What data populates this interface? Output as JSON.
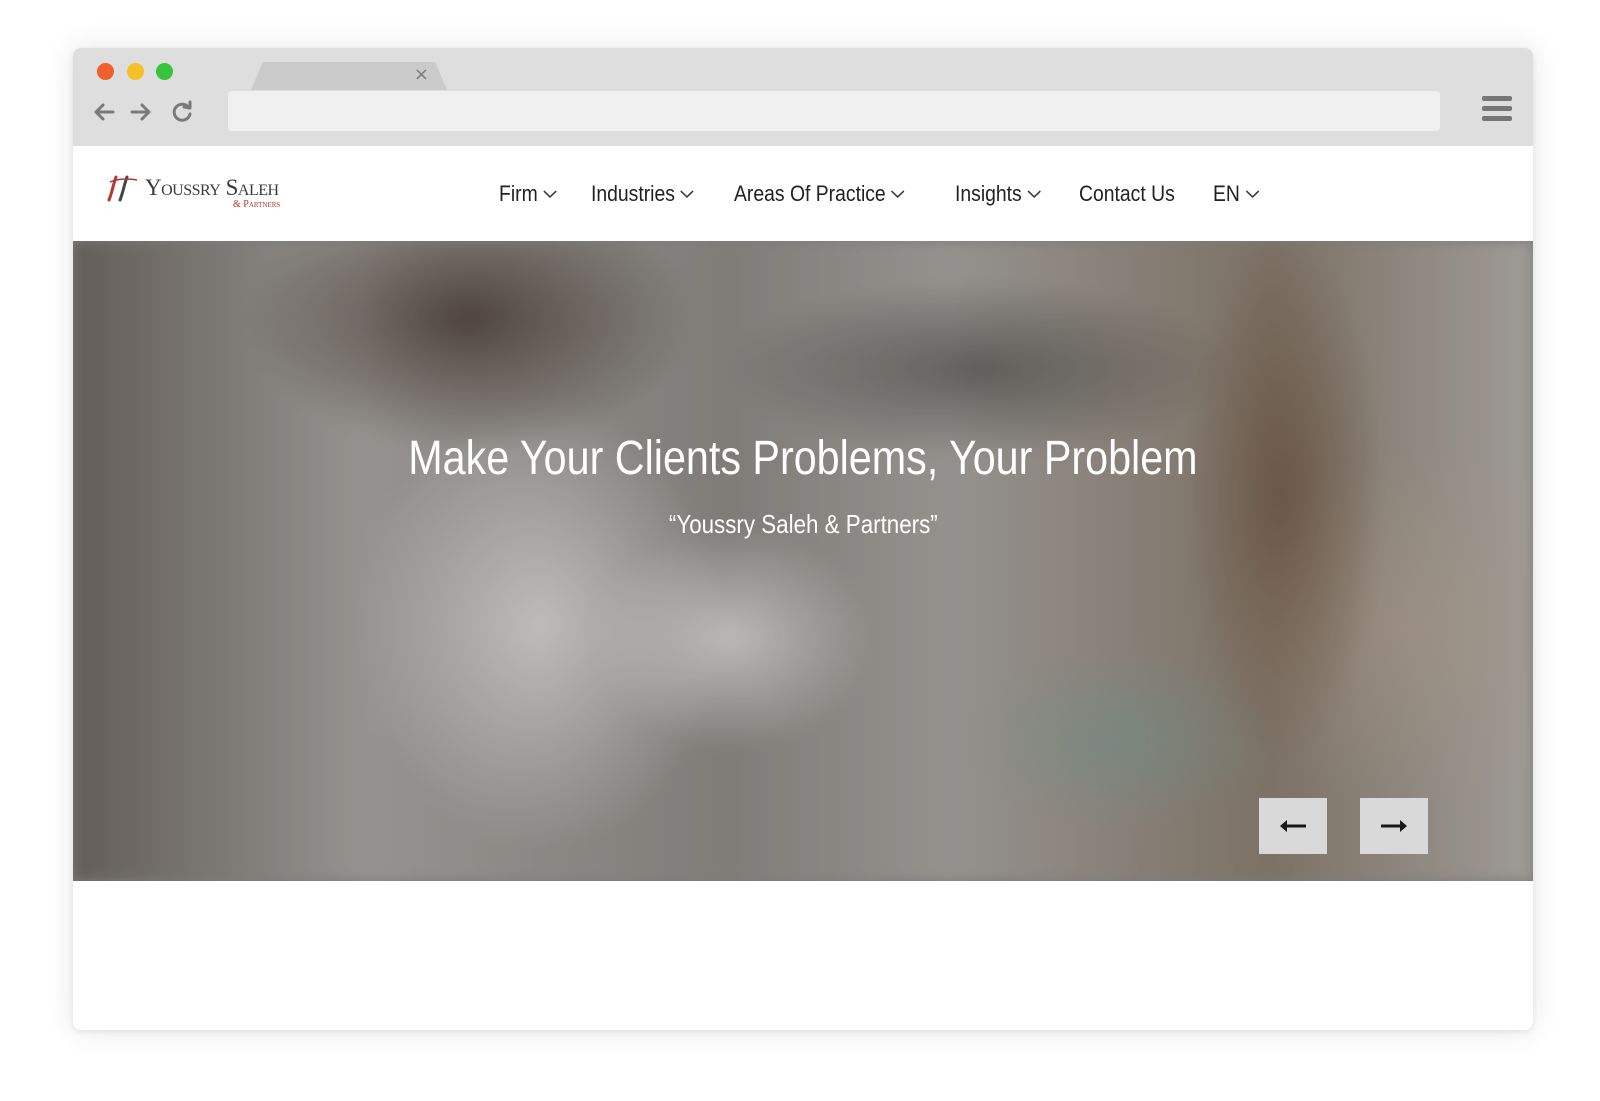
{
  "browser": {
    "tab_close_glyph": "×",
    "url_value": ""
  },
  "site": {
    "logo": {
      "name": "Youssry Saleh",
      "sub": "& Partners",
      "mark_color": "#b03a2e"
    },
    "nav": [
      {
        "label": "Firm",
        "has_dropdown": true
      },
      {
        "label": "Industries",
        "has_dropdown": true
      },
      {
        "label": "Areas Of Practice",
        "has_dropdown": true
      },
      {
        "label": "Insights",
        "has_dropdown": true
      },
      {
        "label": "Contact Us",
        "has_dropdown": false
      },
      {
        "label": "EN",
        "has_dropdown": true
      }
    ],
    "hero": {
      "title": "Make Your Clients Problems, Your Problem",
      "subtitle": "“Youssry Saleh & Partners”",
      "prev_icon": "arrow-left-icon",
      "next_icon": "arrow-right-icon"
    }
  },
  "colors": {
    "chrome": "#dedede",
    "dot_red": "#f0602a",
    "dot_yellow": "#f5c126",
    "dot_green": "#35c43c",
    "nav_text": "#222222",
    "hero_text": "#ffffff"
  }
}
